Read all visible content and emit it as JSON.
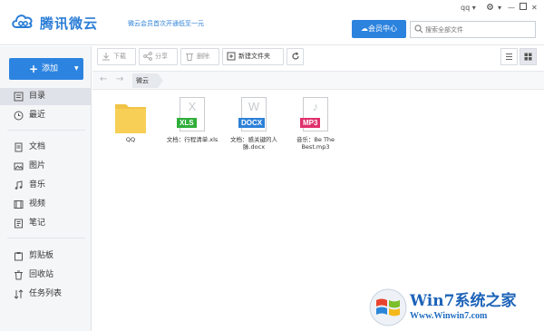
{
  "app": {
    "title": "腾讯微云",
    "promo": "微云会员首次开通低至一元",
    "account": "qq",
    "vip_button": "会员中心",
    "search_placeholder": "搜索全部文件"
  },
  "sidebar": {
    "add_label": "添加",
    "items": [
      {
        "label": "目录",
        "icon": "directory-icon"
      },
      {
        "label": "最近",
        "icon": "clock-icon"
      },
      {
        "label": "文档",
        "icon": "document-icon"
      },
      {
        "label": "图片",
        "icon": "image-icon"
      },
      {
        "label": "音乐",
        "icon": "music-icon"
      },
      {
        "label": "视频",
        "icon": "video-icon"
      },
      {
        "label": "笔记",
        "icon": "note-icon"
      },
      {
        "label": "剪贴板",
        "icon": "clipboard-icon"
      },
      {
        "label": "回收站",
        "icon": "trash-icon"
      },
      {
        "label": "任务列表",
        "icon": "transfer-icon"
      }
    ],
    "active_index": 0
  },
  "toolbar": {
    "download": "下载",
    "share": "分享",
    "delete": "删除",
    "new_folder": "新建文件夹"
  },
  "breadcrumb": {
    "current": "微云"
  },
  "files": [
    {
      "name": "QQ",
      "type": "folder"
    },
    {
      "name": "文档：行程清单.xls",
      "type": "xls",
      "letter": "X",
      "tag": "XLS",
      "color": "#2fae3a"
    },
    {
      "name": "文档：感关键的人脉.docx",
      "type": "docx",
      "letter": "W",
      "tag": "DOCX",
      "color": "#2c80d8"
    },
    {
      "name": "音乐：Be The Best.mp3",
      "type": "mp3",
      "letter": "♪",
      "tag": "MP3",
      "color": "#e0306c"
    }
  ],
  "watermark": {
    "text": "Win7系统之家",
    "url": "Www.Winwin7.com"
  },
  "colors": {
    "accent": "#2c83de",
    "sidebar_bg": "#f5f6f8",
    "folder": "#f7cf56"
  }
}
